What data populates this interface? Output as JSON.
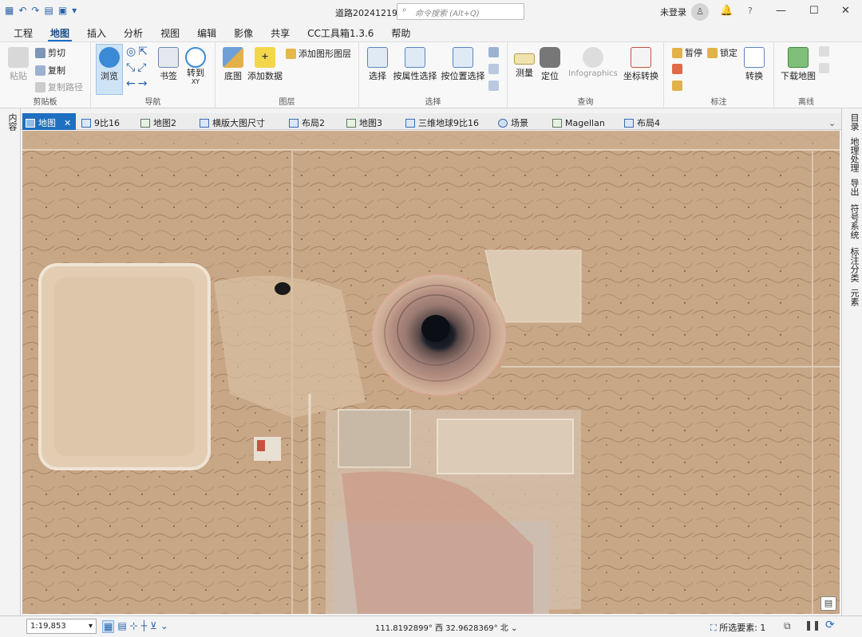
{
  "window": {
    "title": "道路20241219",
    "login": "未登录",
    "search_placeholder": "命令搜索 (Alt+Q)"
  },
  "ribbon_tabs": [
    "工程",
    "地图",
    "插入",
    "分析",
    "视图",
    "编辑",
    "影像",
    "共享",
    "CC工具箱1.3.6",
    "帮助"
  ],
  "active_ribbon_tab": "地图",
  "groups": {
    "clipboard": {
      "label": "剪贴板",
      "paste": "粘贴",
      "cut": "剪切",
      "copy": "复制",
      "copy_path": "复制路径"
    },
    "navigate": {
      "label": "导航",
      "explore": "浏览",
      "bookmarks": "书签",
      "goto": "转到",
      "goto_sub": "XY"
    },
    "layer": {
      "label": "图层",
      "basemap": "底图",
      "add_data": "添加数据",
      "add_graphics": "添加图形图层"
    },
    "selection": {
      "label": "选择",
      "select": "选择",
      "by_attr": "按属性选择",
      "by_loc": "按位置选择"
    },
    "inquiry": {
      "label": "查询",
      "measure": "测量",
      "locate": "定位",
      "infographics": "Infographics",
      "coord_convert": "坐标转换"
    },
    "labeling": {
      "label": "标注",
      "pause": "暂停",
      "lock": "锁定",
      "convert": "转换"
    },
    "offline": {
      "label": "离线",
      "download": "下载地图"
    }
  },
  "doc_tabs": [
    "地图",
    "9比16",
    "地图2",
    "横版大图尺寸",
    "布局2",
    "地图3",
    "三维地球9比16",
    "场景",
    "Magellan",
    "布局4"
  ],
  "left_panel": "内容",
  "right_panel": [
    "目录",
    "地理处理",
    "导出",
    "符号系统",
    "标注分类",
    "元素"
  ],
  "status": {
    "scale": "1:19,853",
    "coords": "111.8192899° 西  32.9628369° 北",
    "selected_label": "所选要素:",
    "selected_count": "1"
  },
  "colors": {
    "accent": "#1e6fc0",
    "terrain": "#c9aa8a"
  }
}
